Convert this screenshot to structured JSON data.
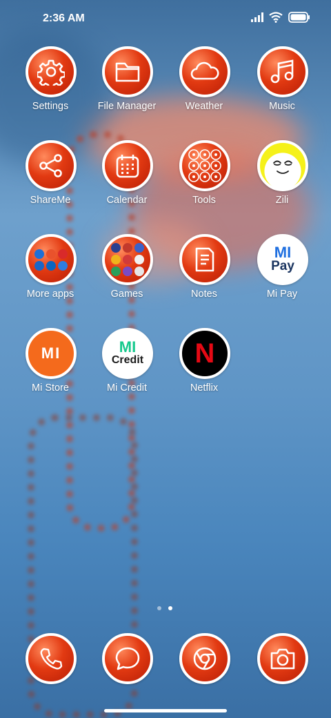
{
  "status": {
    "time": "2:36 AM"
  },
  "apps": [
    {
      "label": "Settings",
      "icon": "gear-icon"
    },
    {
      "label": "File Manager",
      "icon": "folder-icon"
    },
    {
      "label": "Weather",
      "icon": "cloud-icon"
    },
    {
      "label": "Music",
      "icon": "music-note-icon"
    },
    {
      "label": "ShareMe",
      "icon": "share-icon"
    },
    {
      "label": "Calendar",
      "icon": "calendar-icon"
    },
    {
      "label": "Tools",
      "icon": "tools-folder-icon"
    },
    {
      "label": "Zili",
      "icon": "zili-face-icon"
    },
    {
      "label": "More apps",
      "icon": "more-apps-folder-icon"
    },
    {
      "label": "Games",
      "icon": "games-folder-icon"
    },
    {
      "label": "Notes",
      "icon": "notes-icon"
    },
    {
      "label": "Mi Pay",
      "icon": "mi-pay-logo-icon",
      "logo_top": "MI",
      "logo_bottom": "Pay"
    },
    {
      "label": "Mi Store",
      "icon": "mi-store-logo-icon",
      "logo": "MI"
    },
    {
      "label": "Mi Credit",
      "icon": "mi-credit-logo-icon",
      "logo_top": "MI",
      "logo_bottom": "Credit"
    },
    {
      "label": "Netflix",
      "icon": "netflix-logo-icon",
      "logo": "N"
    }
  ],
  "dock": [
    {
      "name": "phone",
      "icon": "phone-icon"
    },
    {
      "name": "messages",
      "icon": "chat-bubble-icon"
    },
    {
      "name": "browser",
      "icon": "chrome-icon"
    },
    {
      "name": "camera",
      "icon": "camera-icon"
    }
  ],
  "pages": {
    "count": 2,
    "active": 2
  },
  "colors": {
    "icon_red": "#e23a12",
    "mi_orange": "#f46a1c",
    "mi_green": "#16c98d",
    "netflix_red": "#e50914",
    "zili_yellow": "#f5f11a"
  }
}
